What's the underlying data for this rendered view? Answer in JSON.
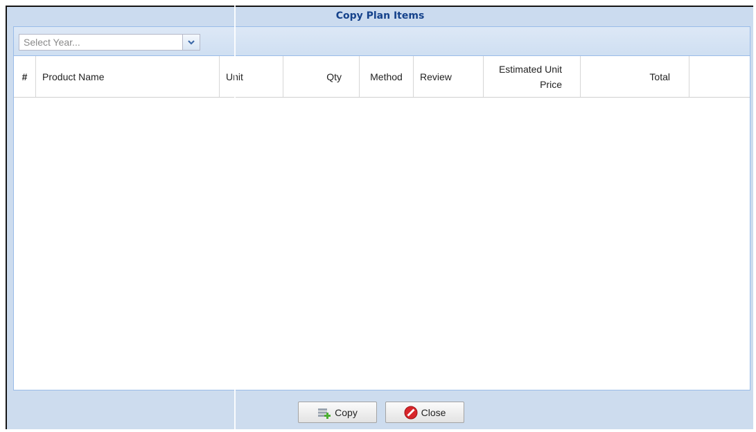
{
  "window": {
    "title": "Copy Plan Items"
  },
  "toolbar": {
    "year_select": {
      "placeholder": "Select Year...",
      "value": ""
    }
  },
  "grid": {
    "columns": [
      "#",
      "Product Name",
      "Unit",
      "Qty",
      "Method",
      "Review",
      "Estimated Unit Price",
      "Total"
    ],
    "rows": []
  },
  "footer": {
    "copy_label": "Copy",
    "close_label": "Close"
  },
  "icons": {
    "dropdown": "chevron-down-icon",
    "copy": "copy-add-icon",
    "close": "stop-icon"
  },
  "colors": {
    "title": "#15428b",
    "frame_bg": "#cddcee",
    "panel_border": "#99bbe8",
    "close_icon": "#d8262b",
    "copy_icon": "#4caf32"
  }
}
